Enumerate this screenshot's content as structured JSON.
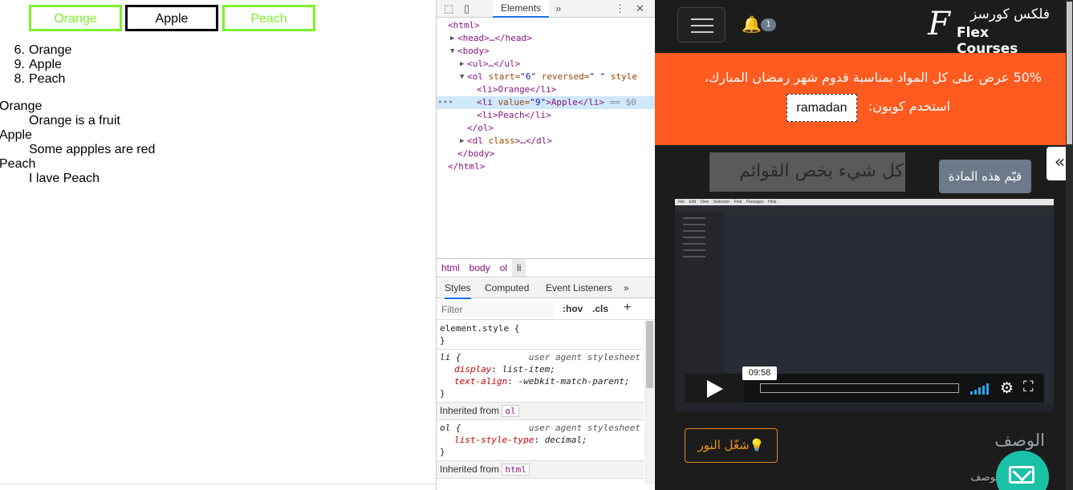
{
  "page": {
    "buttons": [
      {
        "label": "Orange"
      },
      {
        "label": "Apple"
      },
      {
        "label": "Peach"
      }
    ],
    "ordered_list": [
      {
        "number": "6.",
        "text": "Orange"
      },
      {
        "number": "9.",
        "text": "Apple"
      },
      {
        "number": "8.",
        "text": "Peach"
      }
    ],
    "definitions": [
      {
        "term": "Orange",
        "desc": "Orange is a fruit"
      },
      {
        "term": "Apple",
        "desc": "Some appples are red"
      },
      {
        "term": "Peach",
        "desc": "I lave Peach"
      }
    ]
  },
  "devtools": {
    "tab": "Elements",
    "more_tabs": "»",
    "dom": [
      {
        "text": "<html>"
      },
      {
        "text": "<head>…</head>"
      },
      {
        "text": "<body>"
      },
      {
        "text": "<ul>…</ul>"
      },
      {
        "tag": "<ol ",
        "a1": "start=",
        "v1": "\"6\"",
        "a2": " reversed=",
        "v2": "\" \"",
        "a3": " style"
      },
      {
        "text": "<li>Orange</li>"
      },
      {
        "pre": "<li ",
        "attr": "value=",
        "val": "\"9\"",
        "post": ">Apple</li>",
        "suffix": " == $0"
      },
      {
        "text": "<li>Peach</li>"
      },
      {
        "text": "</ol>"
      },
      {
        "tag": "<dl ",
        "a1": "class",
        "rest": ">…</dl>"
      },
      {
        "text": "</body>"
      },
      {
        "text": "</html>"
      }
    ],
    "breadcrumbs": [
      "html",
      "body",
      "ol",
      "li"
    ],
    "pane_tabs": [
      "Styles",
      "Computed",
      "Event Listeners",
      "»"
    ],
    "filter_placeholder": "Filter",
    "hov": ":hov",
    "cls": ".cls",
    "plus": "+",
    "styles": {
      "element_style": "element.style {",
      "close": "}",
      "li_selector": "li {",
      "ua": "user agent stylesheet",
      "li_props": [
        {
          "name": "display",
          "value": "list-item;"
        },
        {
          "name": "text-align",
          "value": "-webkit-match-parent;"
        }
      ],
      "inherited_ol": "Inherited from",
      "inherited_ol_chip": "ol",
      "ol_selector": "ol {",
      "ol_props": [
        {
          "name": "list-style-type",
          "value": "decimal;"
        }
      ],
      "inherited_html": "Inherited from",
      "inherited_html_chip": "html"
    }
  },
  "site": {
    "notification_count": "1",
    "logo_mark": "F",
    "logo_ar": "فلكس كورسز",
    "logo_en": "Flex Courses",
    "promo_text": "50% عرض على كل المواد بمناسبة قدوم شهر رمضان المبارك،",
    "promo_use": "استخدم كوبون:",
    "coupon": "ramadan",
    "side_toggle": "«",
    "lesson_title": "كل شيء يخص القوائم",
    "rate_button": "قيّم هذه المادة",
    "video": {
      "menu_items": [
        "File",
        "Edit",
        "View",
        "Selection",
        "Find",
        "Packages",
        "Help"
      ],
      "time_tooltip": "09:58",
      "progress_fraction": 0.0
    },
    "description_title": "الوصف",
    "light_button": "💡شغّل النور",
    "description_sub": "الوصف"
  },
  "colors": {
    "accent_green": "#7cf12a",
    "promo_orange": "#ff5a1f",
    "teal": "#19c1a6",
    "devtools_blue": "#1a73e8"
  }
}
